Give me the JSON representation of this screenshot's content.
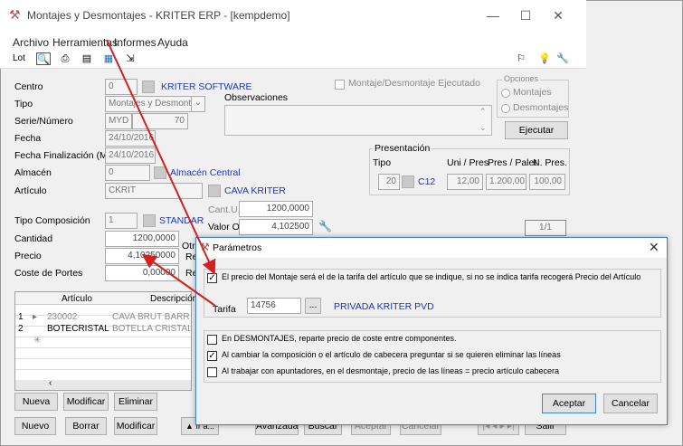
{
  "app": {
    "title": "Montajes y Desmontajes - KRITER ERP - [kempdemo]",
    "window_controls": [
      "—",
      "☐",
      "✕"
    ]
  },
  "menu": [
    "Archivo",
    "Herramientas",
    "Informes",
    "Ayuda"
  ],
  "toolbar": {
    "lot": "Lot",
    "right_icons": [
      "⚐",
      "💡",
      "🔧"
    ]
  },
  "form": {
    "centro": {
      "label": "Centro",
      "value": "0",
      "link": "KRITER SOFTWARE"
    },
    "tipo": {
      "label": "Tipo",
      "value": "Montajes y Desmontaj"
    },
    "serie": {
      "label": "Serie/Número",
      "serie": "MYD",
      "numero": "70"
    },
    "fecha": {
      "label": "Fecha",
      "value": "24/10/2016"
    },
    "fecha_fin": {
      "label": "Fecha Finalización (Mov.)",
      "value": "24/10/2016"
    },
    "almacen": {
      "label": "Almacén",
      "value": "0",
      "link": "Almacén Central"
    },
    "articulo": {
      "label": "Artículo",
      "value": "CKRIT",
      "link": "CAVA KRITER"
    },
    "tipo_comp": {
      "label": "Tipo Composición",
      "value": "1",
      "link": "STANDAR"
    },
    "cantidad": {
      "label": "Cantidad",
      "value": "1200,0000"
    },
    "precio": {
      "label": "Precio",
      "value": "4,10250000"
    },
    "coste_portes": {
      "label": "Coste de Portes",
      "value": "0,00000"
    },
    "cant_uf": {
      "label": "Cant.U.F.",
      "value": "1200,0000"
    },
    "valor_origen": {
      "label": "Valor Origen",
      "value": "4,102500"
    },
    "partial_labels": [
      "Otr",
      "Re",
      "Re"
    ],
    "observaciones": "Observaciones",
    "montaje_ejecutado": "Montaje/Desmontaje Ejecutado",
    "opciones": {
      "title": "Opciones",
      "montajes": "Montajes",
      "desmontajes": "Desmontajes"
    },
    "ejecutar": "Ejecutar",
    "presentacion": {
      "title": "Presentación",
      "tipo": "Tipo",
      "uni_pres": "Uni / Pres",
      "pres_palet": "Pres / Palet",
      "n_pres": "N. Pres.",
      "tipo_val": "20",
      "code": "C12",
      "uni_val": "12,00",
      "palet_val": "1.200,00",
      "npres_val": "100,00"
    },
    "pager": "1/1"
  },
  "grid": {
    "headers": [
      "Artículo",
      "Descripción"
    ],
    "rows": [
      {
        "n": "1",
        "marker": "▸",
        "articulo": "230002",
        "desc": "CAVA BRUT BARROC"
      },
      {
        "n": "2",
        "marker": "",
        "articulo": "BOTECRISTAL",
        "desc": "BOTELLA CRISTAL"
      },
      {
        "n": "",
        "marker": "✳",
        "articulo": "",
        "desc": ""
      }
    ]
  },
  "grid_buttons": [
    "Nueva",
    "Modificar",
    "Eliminar"
  ],
  "bottom_buttons": [
    "Nuevo",
    "Borrar",
    "Modificar",
    "▲ Ir a...",
    "Avanzada",
    "Buscar",
    "Aceptar",
    "Cancelar",
    "Salir"
  ],
  "dialog": {
    "title": "Parámetros",
    "opt1": "El precio del Montaje será el de la tarifa del artículo que se indique, si no se indica tarifa recogerá Precio del Artículo",
    "tarifa_label": "Tarifa",
    "tarifa_value": "14756",
    "tarifa_btn": "...",
    "tarifa_link": "PRIVADA KRITER PVD",
    "opt2": "En DESMONTAJES, reparte precio de coste entre componentes.",
    "opt3": "Al cambiar la composición o el artículo de cabecera preguntar si se quieren eliminar las líneas",
    "opt4": "Al trabajar con apuntadores, en el desmontaje, precio de las líneas = precio artículo cabecera",
    "checked": [
      true,
      false,
      true,
      false
    ],
    "aceptar": "Aceptar",
    "cancelar": "Cancelar"
  },
  "colors": {
    "link": "#1a35c8",
    "accent": "#d32020",
    "dialog_border": "#3f86c8"
  }
}
